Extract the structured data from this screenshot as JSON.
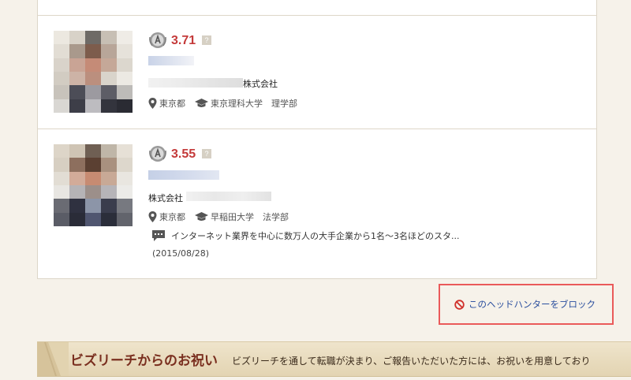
{
  "candidates": [
    {
      "score": "3.71",
      "help_mark": "?",
      "company_suffix": "株式会社",
      "location": "東京都",
      "education": "東京理科大学　理学部"
    },
    {
      "score": "3.55",
      "help_mark": "?",
      "company_prefix": "株式会社",
      "location": "東京都",
      "education": "早稲田大学　法学部",
      "comment": "インターネット業界を中心に数万人の大手企業から1名～3名ほどのスタ...",
      "date": "(2015/08/28)"
    }
  ],
  "block_action": {
    "label": "このヘッドハンターをブロック"
  },
  "banner": {
    "title": "ビズリーチからのお祝い",
    "text": "ビズリーチを通して転職が決まり、ご報告いただいた方には、お祝いを用意しており"
  },
  "colors": {
    "score": "#c43a3a",
    "link": "#2b4f9e",
    "highlight_border": "#ea5a5a"
  },
  "icons": [
    "rank-badge-icon",
    "map-pin-icon",
    "graduation-cap-icon",
    "comment-icon",
    "block-icon"
  ]
}
